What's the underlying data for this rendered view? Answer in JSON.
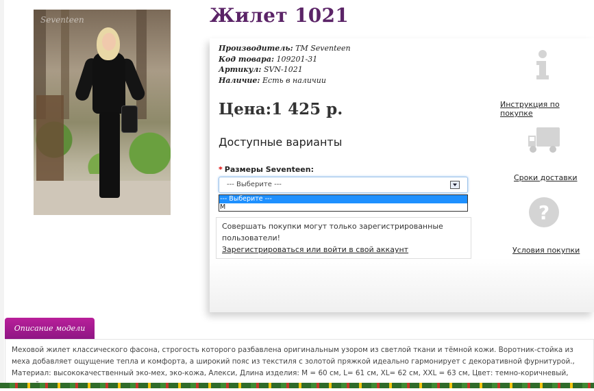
{
  "product": {
    "title": "Жилет 1021",
    "photo_watermark": "Seventeen",
    "manufacturer_label": "Производитель:",
    "manufacturer_value": "TM Seventeen",
    "code_label": "Код товара:",
    "code_value": "109201-31",
    "article_label": "Артикул:",
    "article_value": "SVN-1021",
    "availability_label": "Наличие:",
    "availability_value": "Есть в наличии",
    "price": "Цена:1 425 р.",
    "variants_heading": "Доступные варианты"
  },
  "size_select": {
    "label": "Размеры Seventeen:",
    "required_mark": "*",
    "selected_value": "--- Выберите ---",
    "options": [
      "--- Выберите ---",
      "M"
    ]
  },
  "notice": {
    "text": "Совершать покупки могут только зарегистрированные пользователи!",
    "link": "Зарегистрироваться или войти в свой аккаунт"
  },
  "side_links": {
    "instruction": "Инструкция по покупке",
    "delivery": "Сроки доставки",
    "terms": "Условия покупки"
  },
  "description": {
    "tab_label": "Описание модели",
    "text": "Меховой жилет классического фасона, строгость которого разбавлена оригинальным узором из светлой ткани и тёмной кожи. Воротник-стойка из меха добавляет ощущение тепла и комфорта, а широкий пояс из текстиля с золотой пряжкой идеально гармонирует с декоративной фурнитурой., Материал: высококачественный эко-мех, эко-кожа, Алекси, Длина изделия: M = 60 см, L= 61 см, XL= 62 см, XXL = 63 см, Цвет: темно-коричневый, черный"
  },
  "colors": {
    "title": "#5b2467",
    "tab": "#a01a8f",
    "selected_option": "#1e90ff",
    "icons": "#d2d2d2"
  }
}
